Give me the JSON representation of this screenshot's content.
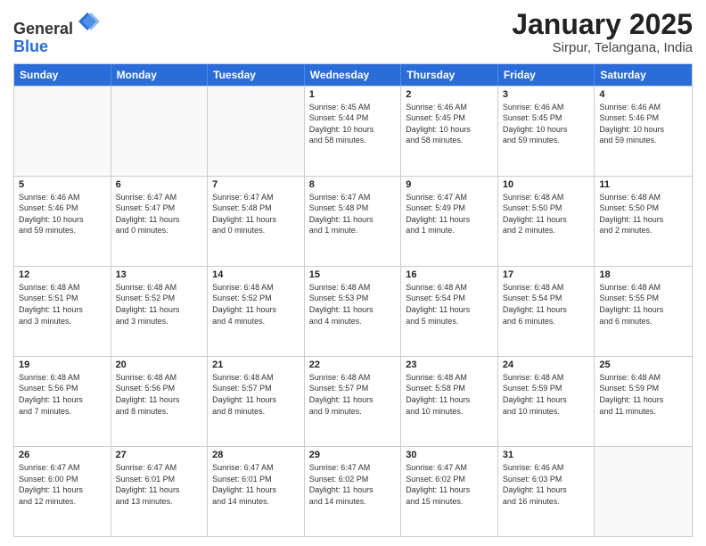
{
  "logo": {
    "general": "General",
    "blue": "Blue"
  },
  "title": "January 2025",
  "subtitle": "Sirpur, Telangana, India",
  "headers": [
    "Sunday",
    "Monday",
    "Tuesday",
    "Wednesday",
    "Thursday",
    "Friday",
    "Saturday"
  ],
  "weeks": [
    [
      {
        "day": "",
        "info": ""
      },
      {
        "day": "",
        "info": ""
      },
      {
        "day": "",
        "info": ""
      },
      {
        "day": "1",
        "info": "Sunrise: 6:45 AM\nSunset: 5:44 PM\nDaylight: 10 hours\nand 58 minutes."
      },
      {
        "day": "2",
        "info": "Sunrise: 6:46 AM\nSunset: 5:45 PM\nDaylight: 10 hours\nand 58 minutes."
      },
      {
        "day": "3",
        "info": "Sunrise: 6:46 AM\nSunset: 5:45 PM\nDaylight: 10 hours\nand 59 minutes."
      },
      {
        "day": "4",
        "info": "Sunrise: 6:46 AM\nSunset: 5:46 PM\nDaylight: 10 hours\nand 59 minutes."
      }
    ],
    [
      {
        "day": "5",
        "info": "Sunrise: 6:46 AM\nSunset: 5:46 PM\nDaylight: 10 hours\nand 59 minutes."
      },
      {
        "day": "6",
        "info": "Sunrise: 6:47 AM\nSunset: 5:47 PM\nDaylight: 11 hours\nand 0 minutes."
      },
      {
        "day": "7",
        "info": "Sunrise: 6:47 AM\nSunset: 5:48 PM\nDaylight: 11 hours\nand 0 minutes."
      },
      {
        "day": "8",
        "info": "Sunrise: 6:47 AM\nSunset: 5:48 PM\nDaylight: 11 hours\nand 1 minute."
      },
      {
        "day": "9",
        "info": "Sunrise: 6:47 AM\nSunset: 5:49 PM\nDaylight: 11 hours\nand 1 minute."
      },
      {
        "day": "10",
        "info": "Sunrise: 6:48 AM\nSunset: 5:50 PM\nDaylight: 11 hours\nand 2 minutes."
      },
      {
        "day": "11",
        "info": "Sunrise: 6:48 AM\nSunset: 5:50 PM\nDaylight: 11 hours\nand 2 minutes."
      }
    ],
    [
      {
        "day": "12",
        "info": "Sunrise: 6:48 AM\nSunset: 5:51 PM\nDaylight: 11 hours\nand 3 minutes."
      },
      {
        "day": "13",
        "info": "Sunrise: 6:48 AM\nSunset: 5:52 PM\nDaylight: 11 hours\nand 3 minutes."
      },
      {
        "day": "14",
        "info": "Sunrise: 6:48 AM\nSunset: 5:52 PM\nDaylight: 11 hours\nand 4 minutes."
      },
      {
        "day": "15",
        "info": "Sunrise: 6:48 AM\nSunset: 5:53 PM\nDaylight: 11 hours\nand 4 minutes."
      },
      {
        "day": "16",
        "info": "Sunrise: 6:48 AM\nSunset: 5:54 PM\nDaylight: 11 hours\nand 5 minutes."
      },
      {
        "day": "17",
        "info": "Sunrise: 6:48 AM\nSunset: 5:54 PM\nDaylight: 11 hours\nand 6 minutes."
      },
      {
        "day": "18",
        "info": "Sunrise: 6:48 AM\nSunset: 5:55 PM\nDaylight: 11 hours\nand 6 minutes."
      }
    ],
    [
      {
        "day": "19",
        "info": "Sunrise: 6:48 AM\nSunset: 5:56 PM\nDaylight: 11 hours\nand 7 minutes."
      },
      {
        "day": "20",
        "info": "Sunrise: 6:48 AM\nSunset: 5:56 PM\nDaylight: 11 hours\nand 8 minutes."
      },
      {
        "day": "21",
        "info": "Sunrise: 6:48 AM\nSunset: 5:57 PM\nDaylight: 11 hours\nand 8 minutes."
      },
      {
        "day": "22",
        "info": "Sunrise: 6:48 AM\nSunset: 5:57 PM\nDaylight: 11 hours\nand 9 minutes."
      },
      {
        "day": "23",
        "info": "Sunrise: 6:48 AM\nSunset: 5:58 PM\nDaylight: 11 hours\nand 10 minutes."
      },
      {
        "day": "24",
        "info": "Sunrise: 6:48 AM\nSunset: 5:59 PM\nDaylight: 11 hours\nand 10 minutes."
      },
      {
        "day": "25",
        "info": "Sunrise: 6:48 AM\nSunset: 5:59 PM\nDaylight: 11 hours\nand 11 minutes."
      }
    ],
    [
      {
        "day": "26",
        "info": "Sunrise: 6:47 AM\nSunset: 6:00 PM\nDaylight: 11 hours\nand 12 minutes."
      },
      {
        "day": "27",
        "info": "Sunrise: 6:47 AM\nSunset: 6:01 PM\nDaylight: 11 hours\nand 13 minutes."
      },
      {
        "day": "28",
        "info": "Sunrise: 6:47 AM\nSunset: 6:01 PM\nDaylight: 11 hours\nand 14 minutes."
      },
      {
        "day": "29",
        "info": "Sunrise: 6:47 AM\nSunset: 6:02 PM\nDaylight: 11 hours\nand 14 minutes."
      },
      {
        "day": "30",
        "info": "Sunrise: 6:47 AM\nSunset: 6:02 PM\nDaylight: 11 hours\nand 15 minutes."
      },
      {
        "day": "31",
        "info": "Sunrise: 6:46 AM\nSunset: 6:03 PM\nDaylight: 11 hours\nand 16 minutes."
      },
      {
        "day": "",
        "info": ""
      }
    ]
  ]
}
